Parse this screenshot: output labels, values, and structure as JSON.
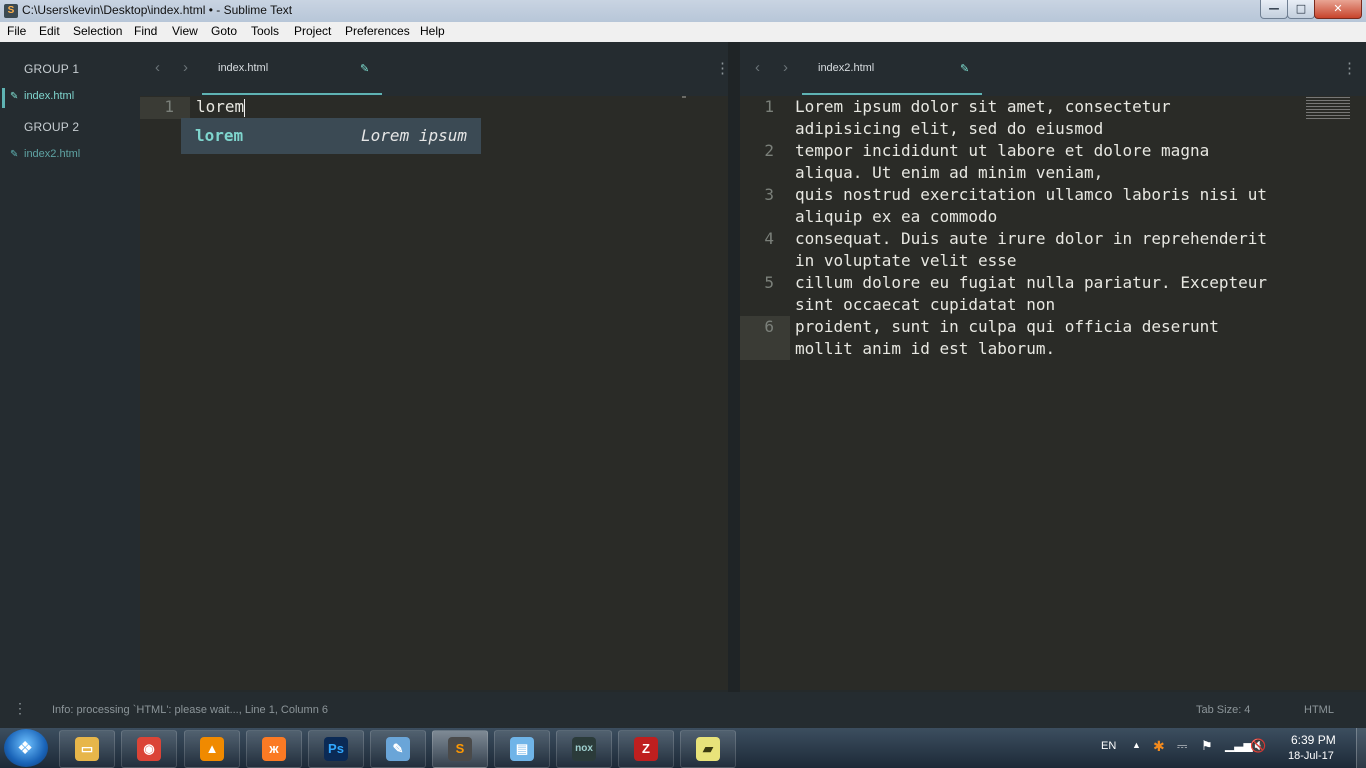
{
  "window": {
    "title": "C:\\Users\\kevin\\Desktop\\index.html • - Sublime Text",
    "app_icon": "S",
    "controls": {
      "minimize": "—",
      "maximize": "□",
      "close": "✕"
    }
  },
  "menu": [
    "File",
    "Edit",
    "Selection",
    "Find",
    "View",
    "Goto",
    "Tools",
    "Project",
    "Preferences",
    "Help"
  ],
  "sidebar": {
    "groups": [
      {
        "label": "GROUP 1",
        "file": "index.html"
      },
      {
        "label": "GROUP 2",
        "file": "index2.html"
      }
    ]
  },
  "left_pane": {
    "tab": "index.html",
    "lines": [
      {
        "num": "1",
        "text": "lorem"
      }
    ],
    "autocomplete": {
      "trigger": "lorem",
      "content": "Lorem ipsum"
    }
  },
  "right_pane": {
    "tab": "index2.html",
    "lines": [
      {
        "num": "1",
        "text": "Lorem ipsum dolor sit amet, consectetur",
        "wrap": "adipisicing elit, sed do eiusmod"
      },
      {
        "num": "2",
        "text": "tempor incididunt ut labore et dolore magna",
        "wrap": "aliqua. Ut enim ad minim veniam,"
      },
      {
        "num": "3",
        "text": "quis nostrud exercitation ullamco laboris nisi ut",
        "wrap": "aliquip ex ea commodo"
      },
      {
        "num": "4",
        "text": "consequat. Duis aute irure dolor in reprehenderit",
        "wrap": "in voluptate velit esse"
      },
      {
        "num": "5",
        "text": "cillum dolore eu fugiat nulla pariatur. Excepteur",
        "wrap": "sint occaecat cupidatat non"
      },
      {
        "num": "6",
        "text": "proident, sunt in culpa qui officia deserunt",
        "wrap": "mollit anim id est laborum."
      }
    ]
  },
  "status": {
    "message": "Info: processing `HTML': please wait..., Line 1, Column 6",
    "tab_size": "Tab Size: 4",
    "syntax": "HTML"
  },
  "taskbar": {
    "apps": [
      {
        "name": "explorer",
        "glyph": "▭",
        "color": "#e7b64a"
      },
      {
        "name": "chrome",
        "glyph": "◉",
        "color": "#db4437"
      },
      {
        "name": "vlc",
        "glyph": "▲",
        "color": "#f08a00"
      },
      {
        "name": "xampp",
        "glyph": "ж",
        "color": "#fb7a24"
      },
      {
        "name": "photoshop",
        "glyph": "Ps",
        "color": "#0b2a55"
      },
      {
        "name": "paint",
        "glyph": "✎",
        "color": "#6aa5d8"
      },
      {
        "name": "sublime-text",
        "glyph": "S",
        "color": "#4a4a4a"
      },
      {
        "name": "notepad",
        "glyph": "▤",
        "color": "#6fb4e8"
      },
      {
        "name": "nox",
        "glyph": "nox",
        "color": "#2b3b3a"
      },
      {
        "name": "filezilla",
        "glyph": "Z",
        "color": "#bf1f1f"
      },
      {
        "name": "sticky-notes",
        "glyph": "▰",
        "color": "#e8e37a"
      }
    ],
    "tray": {
      "language": "EN",
      "time": "6:39 PM",
      "date": "18-Jul-17"
    }
  }
}
